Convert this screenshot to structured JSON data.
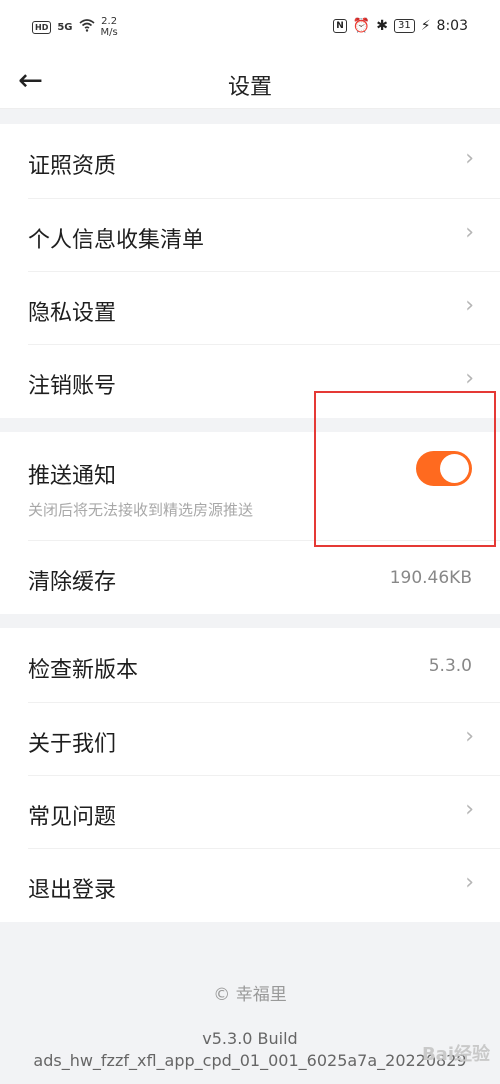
{
  "status_bar": {
    "hd": "HD",
    "signal": "5G",
    "speed_value": "2.2",
    "speed_unit": "M/s",
    "nfc": "N",
    "alarm": "⏰",
    "bluetooth": "✱",
    "battery": "31",
    "charging": "⚡",
    "time": "8:03"
  },
  "nav": {
    "back": "←",
    "title": "设置"
  },
  "section1": {
    "items": [
      {
        "label": "证照资质",
        "chev": "›"
      },
      {
        "label": "个人信息收集清单",
        "chev": "›"
      },
      {
        "label": "隐私设置",
        "chev": "›"
      },
      {
        "label": "注销账号",
        "chev": "›"
      }
    ]
  },
  "section2": {
    "push_label": "推送通知",
    "push_desc": "关闭后将无法接收到精选房源推送",
    "push_enabled": true,
    "cache_label": "清除缓存",
    "cache_value": "190.46KB"
  },
  "section3": {
    "version_label": "检查新版本",
    "version_value": "5.3.0",
    "items": [
      {
        "label": "关于我们",
        "chev": "›"
      },
      {
        "label": "常见问题",
        "chev": "›"
      },
      {
        "label": "退出登录",
        "chev": "›"
      }
    ]
  },
  "footer": {
    "brand": "© 幸福里",
    "build_line1": "v5.3.0 Build",
    "build_line2": "ads_hw_fzzf_xfl_app_cpd_01_001_6025a7a_20220829",
    "watermark": "Bai经验"
  },
  "colors": {
    "toggle_on": "#ff6a1f",
    "annotation_box": "#e53935"
  }
}
